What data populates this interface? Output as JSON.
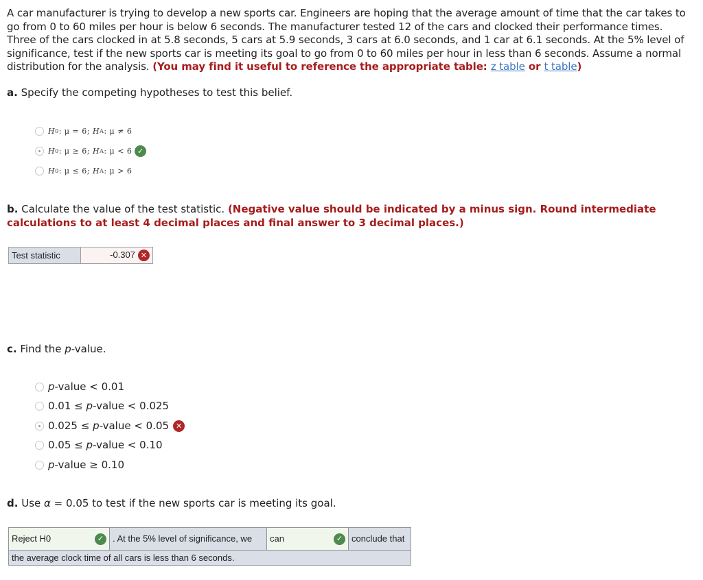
{
  "intro": {
    "text": "A car manufacturer is trying to develop a new sports car. Engineers are hoping that the average amount of time that the car takes to go from 0 to 60 miles per hour is below 6 seconds. The manufacturer tested 12 of the cars and clocked their performance times. Three of the cars clocked in at 5.8 seconds, 5 cars at 5.9 seconds, 3 cars at 6.0 seconds, and 1 car at 6.1 seconds. At the 5% level of significance, test if the new sports car is meeting its goal to go from 0 to 60 miles per hour in less than 6 seconds. Assume a normal distribution for the analysis.",
    "note_prefix": "(You may find it useful to reference the appropriate table:",
    "link_z": "z table",
    "note_or": "or",
    "link_t": "t table",
    "note_suffix": ")"
  },
  "part_a": {
    "label": "a.",
    "question": "Specify the competing hypotheses to test this belief.",
    "options": [
      {
        "h0": "H",
        "h0sub": "0",
        "rel0": ": μ = 6;",
        "ha": "H",
        "hasub": "A",
        "rela": ": μ ≠ 6",
        "selected": false,
        "status": ""
      },
      {
        "h0": "H",
        "h0sub": "0",
        "rel0": ": μ ≥ 6;",
        "ha": "H",
        "hasub": "A",
        "rela": ": μ < 6",
        "selected": true,
        "status": "correct"
      },
      {
        "h0": "H",
        "h0sub": "0",
        "rel0": ": μ ≤ 6;",
        "ha": "H",
        "hasub": "A",
        "rela": ": μ > 6",
        "selected": false,
        "status": ""
      }
    ]
  },
  "part_b": {
    "label": "b.",
    "question": "Calculate the value of the test statistic.",
    "note": "(Negative value should be indicated by a minus sign. Round intermediate calculations to at least 4 decimal places and final answer to 3 decimal places.)",
    "field_label": "Test statistic",
    "field_value": "-0.307",
    "field_status": "incorrect"
  },
  "part_c": {
    "label": "c.",
    "question_prefix": "Find the ",
    "question_p": "p",
    "question_suffix": "-value.",
    "options": [
      {
        "pre": "",
        "p": "p",
        "post": "-value < 0.01",
        "selected": false,
        "status": ""
      },
      {
        "pre": "0.01 ≤ ",
        "p": "p",
        "post": "-value < 0.025",
        "selected": false,
        "status": ""
      },
      {
        "pre": "0.025 ≤ ",
        "p": "p",
        "post": "-value < 0.05",
        "selected": true,
        "status": "incorrect"
      },
      {
        "pre": "0.05 ≤ ",
        "p": "p",
        "post": "-value < 0.10",
        "selected": false,
        "status": ""
      },
      {
        "pre": "",
        "p": "p",
        "post": "-value ≥ 0.10",
        "selected": false,
        "status": ""
      }
    ]
  },
  "part_d": {
    "label": "d.",
    "question_prefix": "Use ",
    "alpha": "α",
    "question_suffix": " = 0.05 to test if the new sports car is meeting its goal.",
    "decision_value": "Reject H0",
    "decision_status": "correct",
    "text1": ". At the 5% level of significance, we",
    "conclusion_value": "can",
    "conclusion_status": "correct",
    "text2": "conclude that",
    "text3": "the average clock time of all cars is less than 6 seconds."
  },
  "icons": {
    "correct": "✓",
    "incorrect": "✕"
  }
}
